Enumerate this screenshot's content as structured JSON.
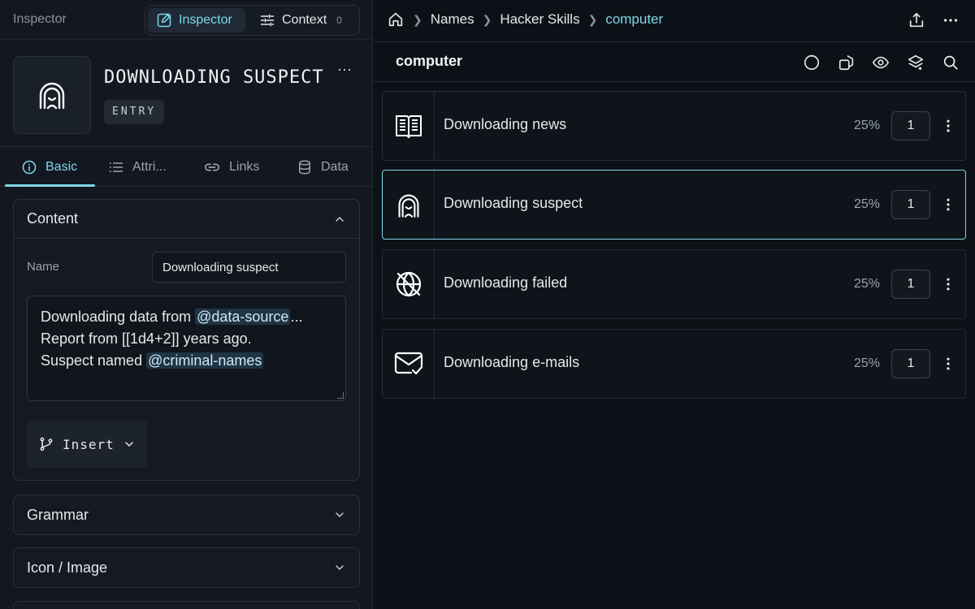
{
  "left": {
    "panel_title": "Inspector",
    "segments": {
      "inspector": "Inspector",
      "context": "Context",
      "context_count": "0"
    },
    "entry": {
      "name": "DOWNLOADING SUSPECT",
      "badge": "ENTRY",
      "more": "···"
    },
    "tabs": [
      {
        "label": "Basic"
      },
      {
        "label": "Attri..."
      },
      {
        "label": "Links"
      },
      {
        "label": "Data"
      }
    ],
    "content": {
      "title": "Content",
      "name_label": "Name",
      "name_value": "Downloading suspect",
      "text": {
        "line1_pre": "Downloading data from ",
        "line1_tag": "@data-source",
        "line1_post": "...",
        "line2": "Report from [[1d4+2]] years ago.",
        "line3_pre": "Suspect named ",
        "line3_tag": "@criminal-names"
      },
      "insert_label": "Insert"
    },
    "sections": {
      "grammar": "Grammar",
      "icon_image": "Icon / Image"
    }
  },
  "right": {
    "breadcrumb": [
      "Names",
      "Hacker Skills",
      "computer"
    ],
    "list_title": "computer",
    "rows": [
      {
        "label": "Downloading news",
        "percent": "25%",
        "count": "1",
        "icon": "newspaper-icon"
      },
      {
        "label": "Downloading suspect",
        "percent": "25%",
        "count": "1",
        "icon": "hooded-figure-icon"
      },
      {
        "label": "Downloading failed",
        "percent": "25%",
        "count": "1",
        "icon": "globe-off-icon"
      },
      {
        "label": "Downloading e-mails",
        "percent": "25%",
        "count": "1",
        "icon": "mail-check-icon"
      }
    ]
  },
  "colors": {
    "accent": "#7fd8ea",
    "background": "#0d1117",
    "panel": "#131820",
    "border": "#262c36"
  }
}
